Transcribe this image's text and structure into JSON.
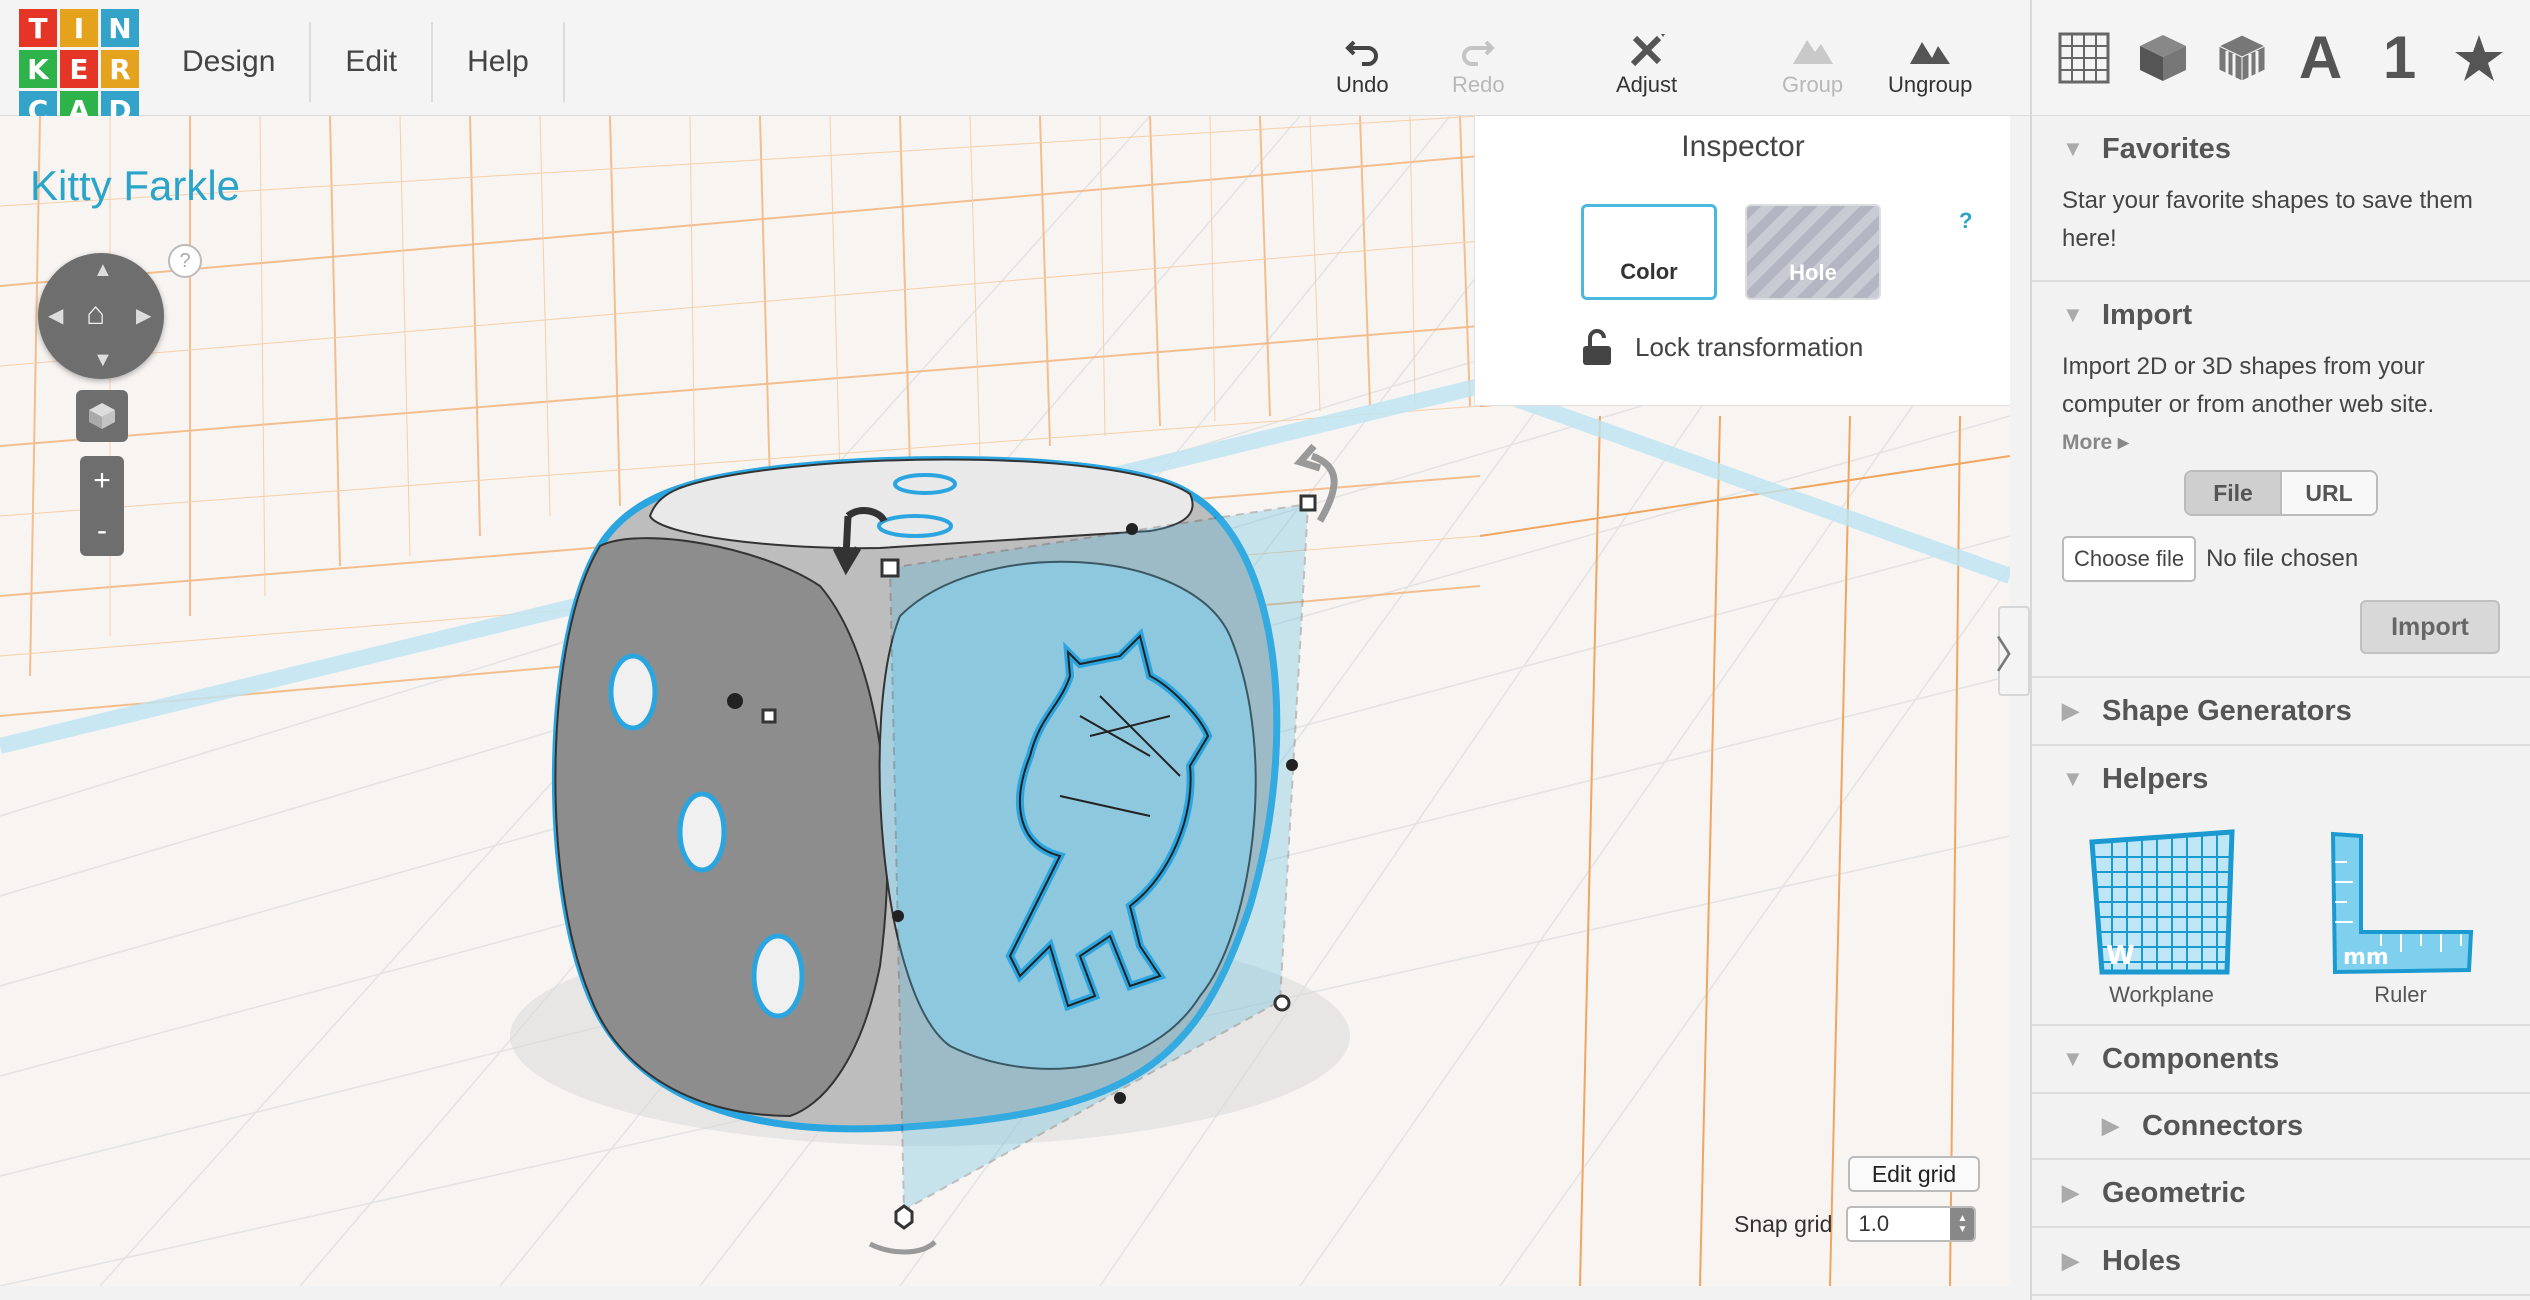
{
  "logo": {
    "letters": [
      "T",
      "I",
      "N",
      "K",
      "E",
      "R",
      "C",
      "A",
      "D"
    ],
    "colors": [
      "#e53527",
      "#e5a21c",
      "#33a3c9",
      "#2eb24a",
      "#e53527",
      "#e5a21c",
      "#33a3c9",
      "#2eb24a",
      "#33a3c9"
    ]
  },
  "menu": {
    "design": "Design",
    "edit": "Edit",
    "help": "Help"
  },
  "toolbar": {
    "undo": "Undo",
    "redo": "Redo",
    "adjust": "Adjust",
    "group": "Group",
    "ungroup": "Ungroup"
  },
  "panel_tabs": {
    "text_tab": "A",
    "number_tab": "1"
  },
  "project": {
    "name": "Kitty Farkle"
  },
  "help_marker": "?",
  "zoom": {
    "in": "+",
    "out": "-"
  },
  "inspector": {
    "title": "Inspector",
    "help": "?",
    "color_label": "Color",
    "hole_label": "Hole",
    "lock_label": "Lock transformation"
  },
  "viewport": {
    "edit_grid": "Edit grid",
    "snap_label": "Snap grid",
    "snap_value": "1.0",
    "accent": "#2aa5c9"
  },
  "panel": {
    "favorites": {
      "title": "Favorites",
      "text": "Star your favorite shapes to save them here!"
    },
    "import": {
      "title": "Import",
      "text": "Import 2D or 3D shapes from your computer or from another web site.",
      "more": "More",
      "file_tab": "File",
      "url_tab": "URL",
      "choose_file": "Choose file",
      "no_file": "No file chosen",
      "button": "Import"
    },
    "shape_generators": {
      "title": "Shape Generators"
    },
    "helpers": {
      "title": "Helpers",
      "workplane": "Workplane",
      "ruler": "Ruler",
      "workplane_badge": "W",
      "ruler_badge": "mm"
    },
    "components": {
      "title": "Components",
      "connectors": "Connectors"
    },
    "geometric": {
      "title": "Geometric"
    },
    "holes": {
      "title": "Holes"
    }
  }
}
